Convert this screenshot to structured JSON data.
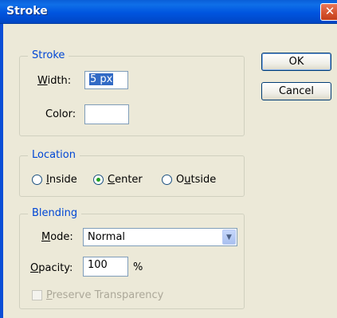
{
  "window": {
    "title": "Stroke",
    "close_symbol": "✕"
  },
  "stroke_group": {
    "legend": "Stroke",
    "width_label_pre": "W",
    "width_label_post": "idth:",
    "width_value": "5 px",
    "color_label": "Color:"
  },
  "buttons": {
    "ok": "OK",
    "cancel": "Cancel"
  },
  "location_group": {
    "legend": "Location",
    "options": [
      {
        "pre": "",
        "key": "I",
        "post": "nside",
        "checked": false
      },
      {
        "pre": "",
        "key": "C",
        "post": "enter",
        "checked": true
      },
      {
        "pre": "O",
        "key": "u",
        "post": "tside",
        "checked": false
      }
    ]
  },
  "blending_group": {
    "legend": "Blending",
    "mode_label_pre": "M",
    "mode_label_post": "ode:",
    "mode_value": "Normal",
    "opacity_label_pre": "O",
    "opacity_label_post": "pacity:",
    "opacity_value": "100",
    "opacity_unit": "%",
    "preserve_pre": "P",
    "preserve_post": "reserve Transparency",
    "preserve_checked": false
  },
  "icons": {
    "dropdown_arrow": "chevron-down-icon"
  }
}
